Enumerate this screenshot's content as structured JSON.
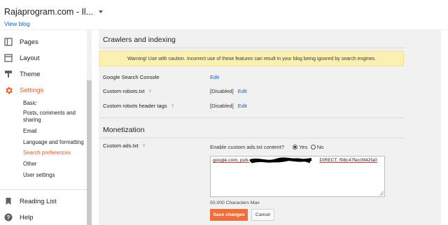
{
  "header": {
    "blog_title": "Rajaprogram.com - Il...",
    "view_blog": "View blog"
  },
  "sidebar": {
    "items": [
      {
        "label": "Pages",
        "icon": "pages-icon"
      },
      {
        "label": "Layout",
        "icon": "layout-icon"
      },
      {
        "label": "Theme",
        "icon": "theme-icon"
      },
      {
        "label": "Settings",
        "icon": "gear-icon",
        "active": true
      }
    ],
    "sub_items": [
      {
        "label": "Basic"
      },
      {
        "label": "Posts, comments and sharing"
      },
      {
        "label": "Email"
      },
      {
        "label": "Language and formatting"
      },
      {
        "label": "Search preferences",
        "active": true
      },
      {
        "label": "Other"
      },
      {
        "label": "User settings"
      }
    ],
    "bottom_items": [
      {
        "label": "Reading List",
        "icon": "bookmark-icon"
      },
      {
        "label": "Help",
        "icon": "help-icon"
      }
    ],
    "active_color": "#e65a25"
  },
  "crawlers": {
    "title": "Crawlers and indexing",
    "warning": "Warning! Use with caution. Incorrect use of these features can result in your blog being ignored by search engines.",
    "rows": [
      {
        "label": "Google Search Console",
        "status": "",
        "action": "Edit"
      },
      {
        "label": "Custom robots.txt",
        "help": "?",
        "status": "[Disabled]",
        "action": "Edit"
      },
      {
        "label": "Custom robots header tags",
        "help": "?",
        "status": "[Disabled]",
        "action": "Edit"
      }
    ]
  },
  "monetization": {
    "title": "Monetization",
    "ads_label": "Custom ads.txt",
    "ads_help": "?",
    "question": "Enable custom ads.txt content?",
    "yes": "Yes",
    "no": "No",
    "ads_value_start": "google.com, pub-",
    "ads_value_end": "DIRECT, f08c47fec0942fa0",
    "char_max": "50,000 Characters Max",
    "save": "Save changes",
    "cancel": "Cancel",
    "accent": "#f06e3a"
  }
}
